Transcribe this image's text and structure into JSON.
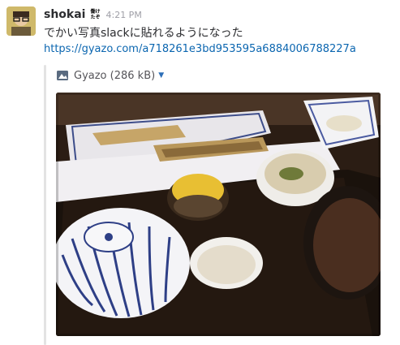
{
  "message": {
    "username": "shokai",
    "badge_line1": "働け",
    "badge_line2": "たぞ",
    "timestamp": "4:21 PM",
    "text": "でかい写真slackに貼れるようになった",
    "link": "https://gyazo.com/a718261e3bd953595a6884006788227a"
  },
  "attachment": {
    "service_icon": "gyazo-icon",
    "title": "Gyazo (286 kB)",
    "toggle_icon": "caret-down-icon"
  },
  "image": {
    "description_icon": "meal-photo"
  }
}
